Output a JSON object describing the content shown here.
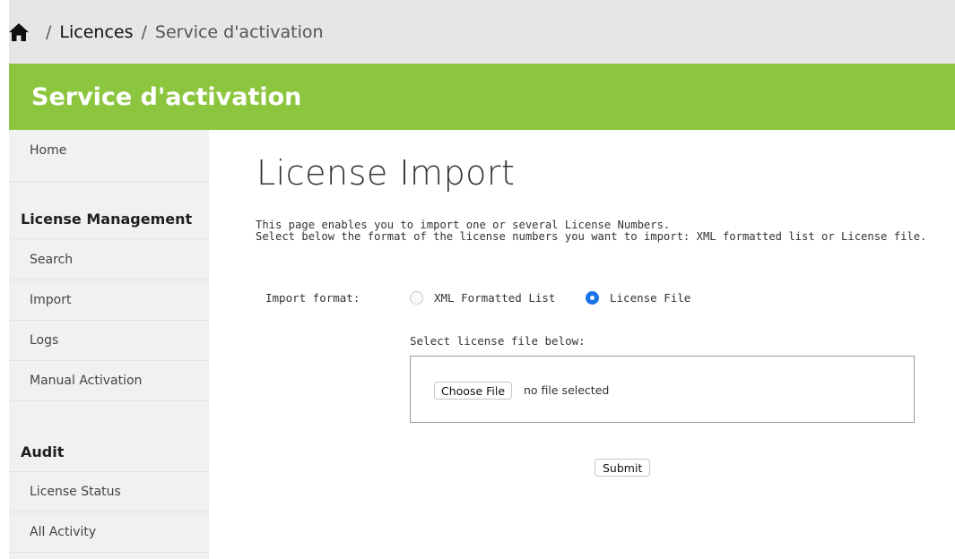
{
  "breadcrumb": {
    "home_icon": "home-icon",
    "separator": "/",
    "items": [
      "Licences",
      "Service d'activation"
    ]
  },
  "header": {
    "title": "Service d'activation",
    "color": "#8cc63f"
  },
  "sidebar": {
    "home": "Home",
    "license_management": {
      "heading": "License Management",
      "items": [
        "Search",
        "Import",
        "Logs",
        "Manual Activation"
      ]
    },
    "audit": {
      "heading": "Audit",
      "items": [
        "License Status",
        "All Activity"
      ]
    }
  },
  "main": {
    "title": "License Import",
    "intro_line1": "This page enables you to import one or several License Numbers.",
    "intro_line2": "Select below the format of the license numbers you want to import: XML formatted list or License file.",
    "import_format_label": "Import format:",
    "options": [
      "XML Formatted List",
      "License File"
    ],
    "selected_option": "License File",
    "select_file_label": "Select license file below:",
    "choose_file_label": "Choose File",
    "file_status": "no file selected",
    "submit_label": "Submit",
    "accent_color": "#1a73e8"
  }
}
